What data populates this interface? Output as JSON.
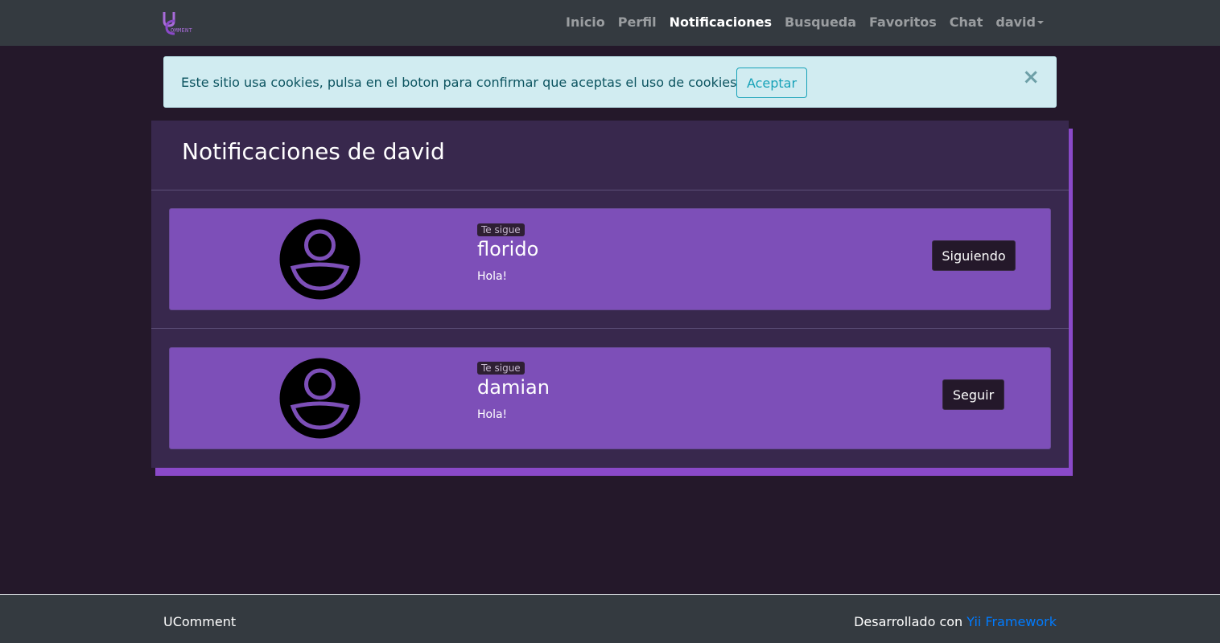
{
  "brand": {
    "letter": "U",
    "text": "OMMENT"
  },
  "nav": {
    "items": [
      {
        "label": "Inicio",
        "active": false
      },
      {
        "label": "Perfil",
        "active": false
      },
      {
        "label": "Notificaciones",
        "active": true
      },
      {
        "label": "Busqueda",
        "active": false
      },
      {
        "label": "Favoritos",
        "active": false
      },
      {
        "label": "Chat",
        "active": false
      }
    ],
    "user_menu": "david"
  },
  "cookie_alert": {
    "text": "Este sitio usa cookies, pulsa en el boton para confirmar que aceptas el uso de cookies",
    "accept_label": "Aceptar",
    "close_symbol": "×"
  },
  "main": {
    "title": "Notificaciones de david",
    "notifications": [
      {
        "badge": "Te sigue",
        "username": "florido",
        "message": "Hola!",
        "action_label": "Siguiendo",
        "avatar_icon": "user-avatar-icon"
      },
      {
        "badge": "Te sigue",
        "username": "damian",
        "message": "Hola!",
        "action_label": "Seguir",
        "avatar_icon": "user-avatar-icon"
      }
    ]
  },
  "footer": {
    "left": "UComment",
    "right_prefix": "Desarrollado con ",
    "right_link": "Yii Framework"
  },
  "colors": {
    "page_bg": "#24182a",
    "navbar_bg": "#343a40",
    "card_bg": "#38284d",
    "notification_bg": "#7d4fb8",
    "accent_shadow": "#8a49c9",
    "alert_bg": "#d1ecf1",
    "link": "#007bff"
  }
}
